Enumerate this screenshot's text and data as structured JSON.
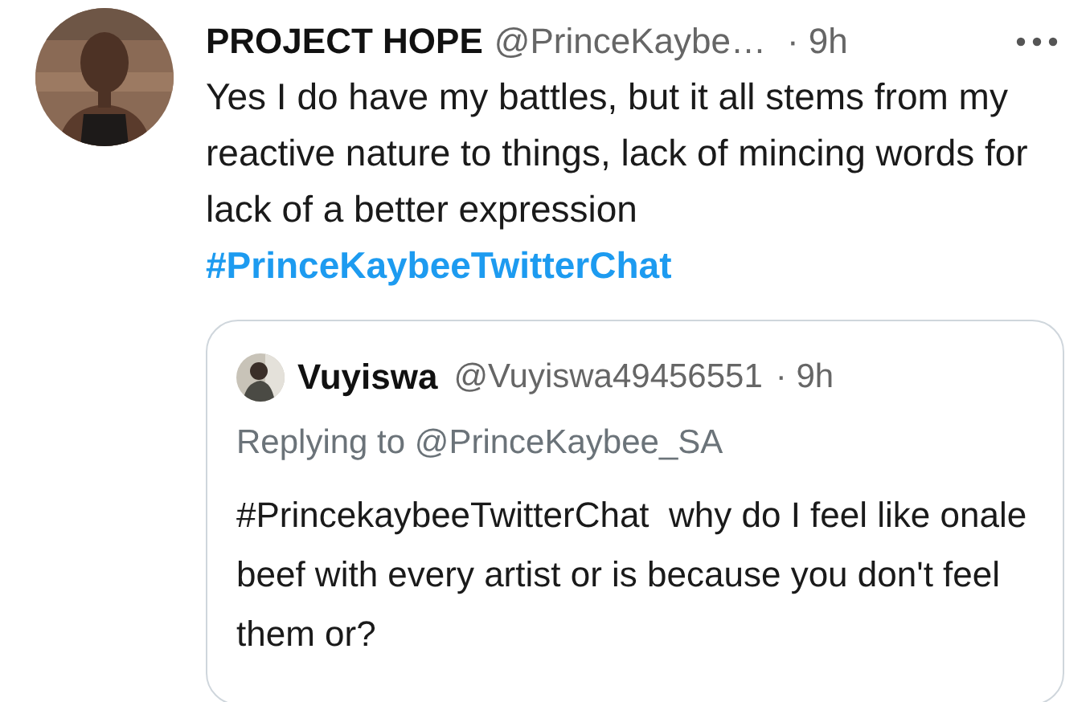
{
  "tweet": {
    "name": "PROJECT HOPE",
    "handle": "@PrinceKaybe…",
    "time": "· 9h",
    "text": "Yes I do have my battles, but it all stems from my reactive nature to things, lack of mincing words for lack of a better expression",
    "hashtag": "#PrinceKaybeeTwitterChat",
    "quote": {
      "name": "Vuyiswa",
      "handle": "@Vuyiswa49456551",
      "time": "· 9h",
      "replying_to": "Replying to @PrinceKaybee_SA",
      "text": "#PrincekaybeeTwitterChat  why do I feel like onale beef with every artist or is because you don't feel them or?"
    }
  }
}
